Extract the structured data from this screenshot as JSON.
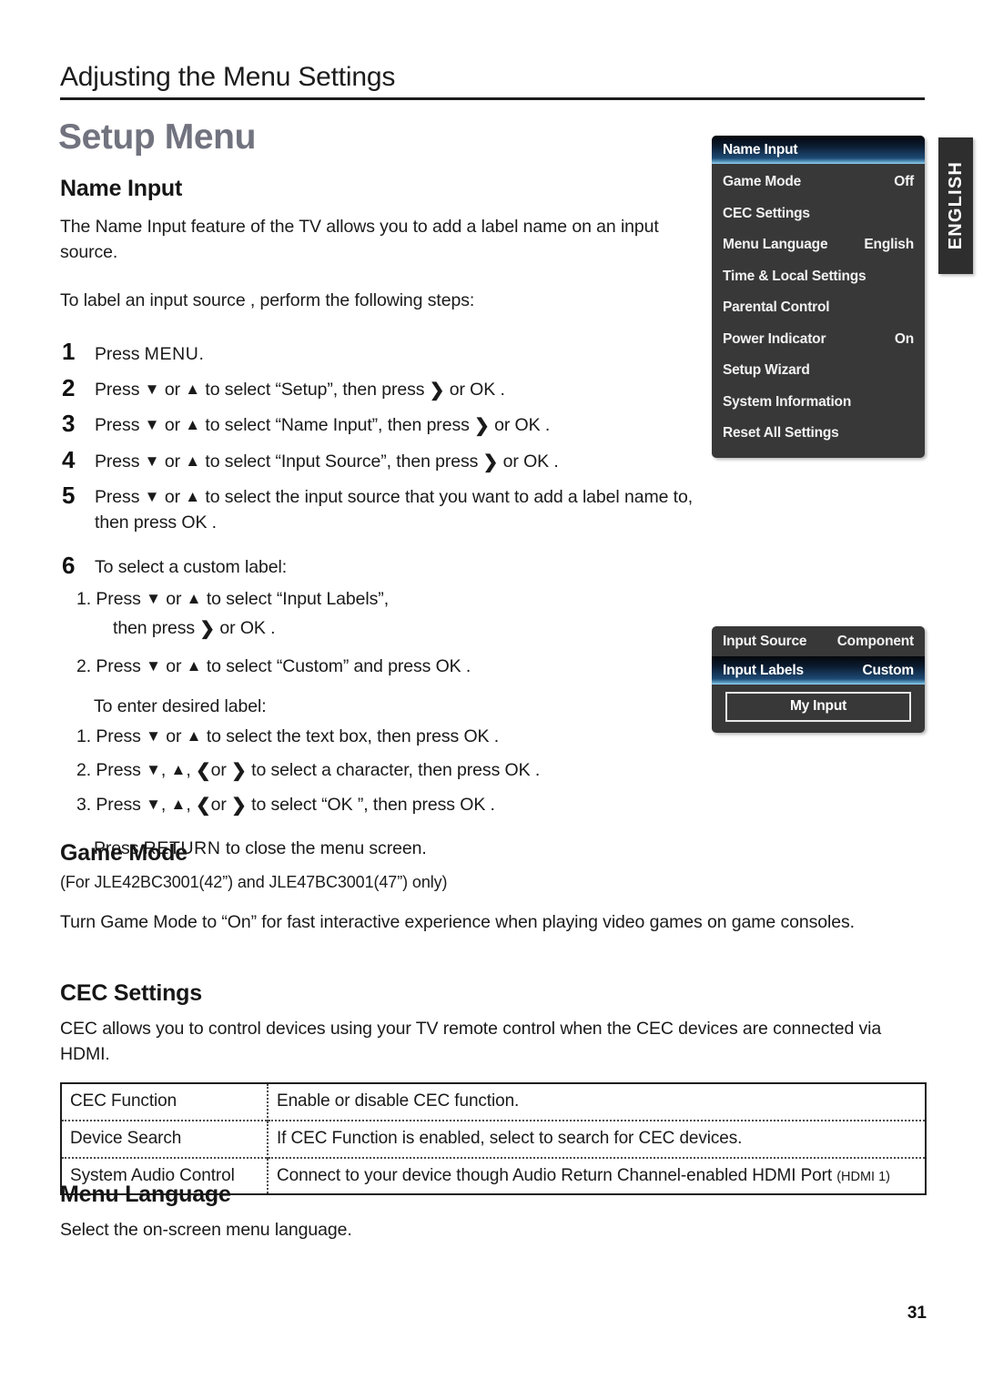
{
  "header": {
    "chapter_title": "Adjusting the Menu Settings",
    "page_title": "Setup Menu"
  },
  "language_tab": {
    "label": "ENGLISH"
  },
  "page_number": "31",
  "sections": {
    "name_input": {
      "heading": "Name Input",
      "intro": "The Name Input feature of the TV allows you to add a label name on an input source.",
      "lead_in": "To label an input source , perform the following steps:",
      "steps": [
        {
          "num": "1",
          "text_before": "Press ",
          "kbd": "MENU",
          "text_after": "."
        },
        {
          "num": "2",
          "prefix": "Press ",
          "arrow_down": "▼",
          "mid1": " or ",
          "arrow_up": "▲",
          "mid2": " to select “Setup”, then press ",
          "arrow_right": "❯",
          "suffix": " or OK ."
        },
        {
          "num": "3",
          "prefix": "Press ",
          "arrow_down": "▼",
          "mid1": " or ",
          "arrow_up": "▲",
          "mid2": " to select “Name Input”, then press ",
          "arrow_right": "❯",
          "suffix": " or OK ."
        },
        {
          "num": "4",
          "prefix": "Press ",
          "arrow_down": "▼",
          "mid1": " or ",
          "arrow_up": "▲",
          "mid2": " to select “Input Source”, then press ",
          "arrow_right": "❯",
          "suffix": " or OK ."
        },
        {
          "num": "5",
          "prefix": "Press ",
          "arrow_down": "▼",
          "mid1": " or ",
          "arrow_up": "▲",
          "mid2": " to select the input source that you want to add a label name to, then press OK ."
        }
      ],
      "step6": {
        "num": "6",
        "title": "To select a custom label:",
        "custom_label_items": [
          {
            "marker": "1.",
            "prefix": " Press ",
            "arrow_down": "▼",
            "mid1": " or ",
            "arrow_up": "▲",
            "mid2": " to select “Input Labels”,",
            "line2": "then press ",
            "arrow_right": "❯",
            "suffix": " or OK ."
          },
          {
            "marker": "2.",
            "prefix": " Press ",
            "arrow_down": "▼",
            "mid1": " or ",
            "arrow_up": "▲",
            "mid2": " to select “Custom” and press OK ."
          }
        ],
        "enter_label_title": "To enter desired label:",
        "enter_label_items": [
          {
            "marker": "1.",
            "prefix": " Press ",
            "arrow_down": "▼",
            "mid1": " or ",
            "arrow_up": "▲",
            "mid2": " to select the text box, then press OK ."
          },
          {
            "marker": "2.",
            "prefix": " Press ",
            "arrow_down": "▼",
            "mid1": ", ",
            "arrow_up": "▲",
            "mid2": ", ",
            "arrow_left": "❮",
            "mid3": "or ",
            "arrow_right": "❯",
            "suffix": " to select a character, then press OK ."
          },
          {
            "marker": "3.",
            "prefix": " Press ",
            "arrow_down": "▼",
            "mid1": ", ",
            "arrow_up": "▲",
            "mid2": ", ",
            "arrow_left": "❮",
            "mid3": "or ",
            "arrow_right": "❯",
            "suffix": " to select “OK ”, then press OK ."
          }
        ],
        "closing_before": "Press ",
        "closing_kbd": "RETURN",
        "closing_after": " to close the menu screen."
      }
    },
    "game_mode": {
      "heading": "Game Mode",
      "model_note": "(For JLE42BC3001(42”) and JLE47BC3001(47”) only)",
      "body": "Turn Game Mode to “On” for fast interactive experience when playing video games on game consoles."
    },
    "cec_settings": {
      "heading": "CEC Settings",
      "body": "CEC allows you to control devices using your TV remote control when the CEC devices are connected via HDMI.",
      "table": {
        "rows": [
          {
            "name": "CEC Function",
            "desc": "Enable or disable CEC function.",
            "note": ""
          },
          {
            "name": "Device Search",
            "desc": "If CEC Function is enabled, select to search for CEC devices.",
            "note": ""
          },
          {
            "name": "System Audio Control",
            "desc": "Connect to your device though Audio Return Channel-enabled HDMI Port ",
            "note": "(HDMI 1)"
          }
        ]
      }
    },
    "menu_language": {
      "heading": "Menu Language",
      "body": "Select the on-screen menu language."
    }
  },
  "tv_menus": {
    "setup_menu": {
      "selected_item": "Name Input",
      "items": [
        {
          "label": "Game Mode",
          "value": "Off"
        },
        {
          "label": "CEC Settings",
          "value": ""
        },
        {
          "label": "Menu Language",
          "value": "English"
        },
        {
          "label": "Time & Local Settings",
          "value": ""
        },
        {
          "label": "Parental Control",
          "value": ""
        },
        {
          "label": "Power Indicator",
          "value": "On"
        },
        {
          "label": "Setup Wizard",
          "value": ""
        },
        {
          "label": "System Information",
          "value": ""
        },
        {
          "label": "Reset All Settings",
          "value": ""
        }
      ]
    },
    "name_input_menu": {
      "rows": [
        {
          "label": "Input Source",
          "value": "Component",
          "selected": false
        },
        {
          "label": "Input Labels",
          "value": "Custom",
          "selected": true
        }
      ],
      "textbox_value": "My Input"
    }
  }
}
